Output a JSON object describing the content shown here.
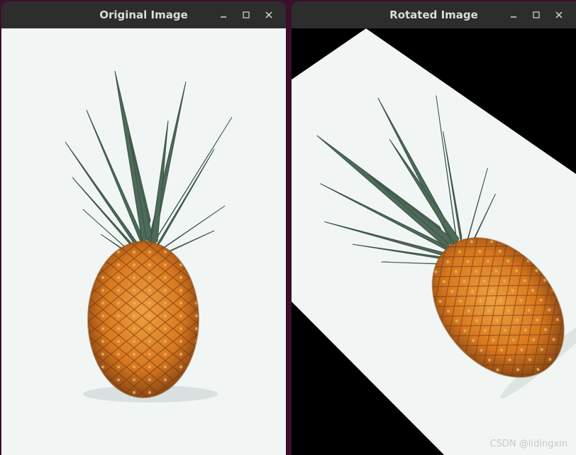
{
  "left_window": {
    "title": "Original Image",
    "controls": {
      "minimize": "–",
      "maximize": "□",
      "close": "✕"
    }
  },
  "right_window": {
    "title": "Rotated Image",
    "controls": {
      "minimize": "–",
      "maximize": "□",
      "close": "✕"
    }
  },
  "watermark": "CSDN @lidingxin",
  "colors": {
    "desktop": "#3b0f2a",
    "titlebar": "#2d2d2d",
    "title_text": "#dcdcdc",
    "image_bg": "#f1f6f5",
    "rotation_fill": "#000000",
    "leaf": "#4e6a58",
    "fruit": "#d9781e"
  },
  "content": {
    "subject": "pineapple"
  }
}
